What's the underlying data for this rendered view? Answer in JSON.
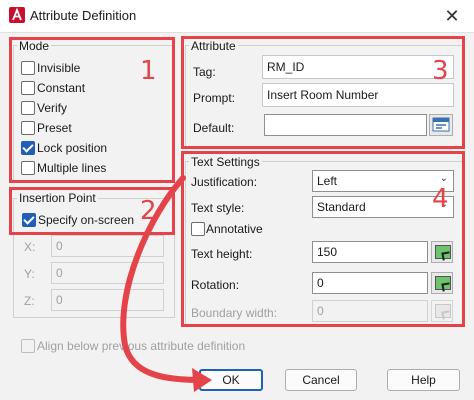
{
  "window": {
    "title": "Attribute Definition"
  },
  "mode": {
    "title": "Mode",
    "items": [
      {
        "label": "Invisible",
        "checked": false
      },
      {
        "label": "Constant",
        "checked": false
      },
      {
        "label": "Verify",
        "checked": false
      },
      {
        "label": "Preset",
        "checked": false
      },
      {
        "label": "Lock position",
        "checked": true
      },
      {
        "label": "Multiple lines",
        "checked": false
      }
    ]
  },
  "attribute": {
    "title": "Attribute",
    "tag_label": "Tag:",
    "tag_value": "RM_ID",
    "prompt_label": "Prompt:",
    "prompt_value": "Insert Room Number",
    "default_label": "Default:",
    "default_value": ""
  },
  "insertion_point": {
    "title": "Insertion Point",
    "specify_label": "Specify on-screen",
    "specify_checked": true,
    "x_label": "X:",
    "x_value": "0",
    "y_label": "Y:",
    "y_value": "0",
    "z_label": "Z:",
    "z_value": "0"
  },
  "text_settings": {
    "title": "Text Settings",
    "justification_label": "Justification:",
    "justification_value": "Left",
    "text_style_label": "Text style:",
    "text_style_value": "Standard",
    "annotative_label": "Annotative",
    "annotative_checked": false,
    "text_height_label": "Text height:",
    "text_height_value": "150",
    "rotation_label": "Rotation:",
    "rotation_value": "0",
    "boundary_width_label": "Boundary width:",
    "boundary_width_value": "0"
  },
  "align_below_label": "Align below previous attribute definition",
  "buttons": {
    "ok": "OK",
    "cancel": "Cancel",
    "help": "Help"
  },
  "annotations": {
    "n1": "1",
    "n2": "2",
    "n3": "3",
    "n4": "4"
  },
  "colors": {
    "highlight": "#e5434a",
    "accent": "#1f5fb4",
    "dialog_bg": "#f2f2f2"
  }
}
